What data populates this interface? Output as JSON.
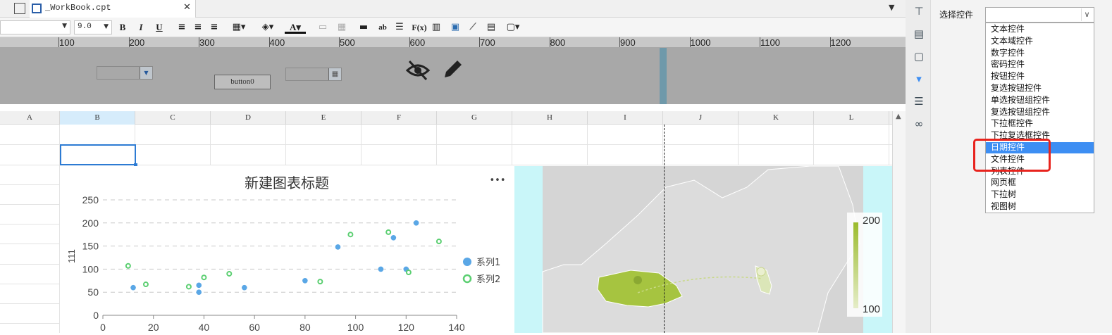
{
  "tab": {
    "title": "_WorkBook.cpt"
  },
  "toolbar": {
    "font_size": "9.0",
    "bold": "B",
    "italic": "I",
    "underline": "U",
    "abc": "ab",
    "fx": "F(x)"
  },
  "ruler": {
    "marks": [
      "100",
      "200",
      "300",
      "400",
      "500",
      "600",
      "700",
      "800",
      "900",
      "1000",
      "1100",
      "1200"
    ]
  },
  "form": {
    "button_label": "button0"
  },
  "sheet": {
    "columns": [
      "A",
      "B",
      "C",
      "D",
      "E",
      "F",
      "G",
      "H",
      "I",
      "J",
      "K",
      "L"
    ]
  },
  "chart_data": {
    "type": "scatter",
    "title": "新建图表标题",
    "ylabel": "111",
    "xlim": [
      0,
      140
    ],
    "ylim": [
      0,
      250
    ],
    "xticks": [
      "0",
      "20",
      "40",
      "60",
      "80",
      "100",
      "120",
      "140"
    ],
    "yticks": [
      "0",
      "50",
      "100",
      "150",
      "200",
      "250"
    ],
    "legend_position": "right",
    "menu_glyph": "•••",
    "series": [
      {
        "name": "系列1",
        "color": "#5aa7e6",
        "filled": true,
        "points": [
          [
            12,
            60
          ],
          [
            38,
            65
          ],
          [
            38,
            50
          ],
          [
            56,
            60
          ],
          [
            80,
            75
          ],
          [
            93,
            148
          ],
          [
            110,
            100
          ],
          [
            115,
            168
          ],
          [
            120,
            100
          ],
          [
            124,
            200
          ]
        ]
      },
      {
        "name": "系列2",
        "color": "#5ccf72",
        "filled": false,
        "points": [
          [
            10,
            107
          ],
          [
            17,
            67
          ],
          [
            34,
            62
          ],
          [
            40,
            82
          ],
          [
            50,
            90
          ],
          [
            86,
            73
          ],
          [
            98,
            175
          ],
          [
            113,
            180
          ],
          [
            121,
            93
          ],
          [
            133,
            160
          ]
        ]
      }
    ]
  },
  "map": {
    "legend_max": "200",
    "legend_min": "100",
    "colors": {
      "high": "#9bbb2c",
      "low": "#e5edc8"
    }
  },
  "panel": {
    "label": "选择控件",
    "options": [
      "文本控件",
      "文本域控件",
      "数字控件",
      "密码控件",
      "按钮控件",
      "复选按钮控件",
      "单选按钮组控件",
      "复选按钮组控件",
      "下拉框控件",
      "下拉复选框控件",
      "日期控件",
      "文件控件",
      "列表控件",
      "网页框",
      "下拉树",
      "视图树"
    ],
    "selected_index": 10,
    "selected_color": "#3d8ef3",
    "highlight_color": "#e8231d"
  }
}
